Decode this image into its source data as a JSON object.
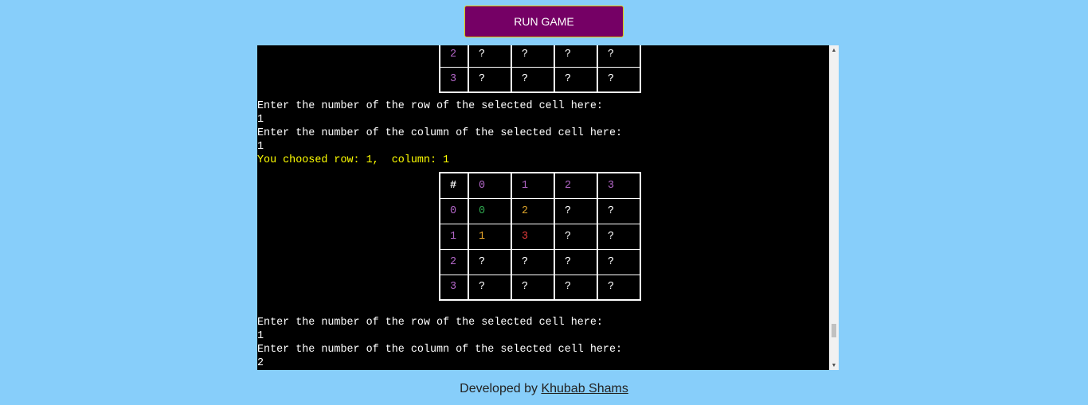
{
  "run_button": {
    "label": "RUN GAME"
  },
  "terminal": {
    "top_board_rows": [
      {
        "row": "2",
        "cells": [
          "?",
          "?",
          "?",
          "?"
        ]
      },
      {
        "row": "3",
        "cells": [
          "?",
          "?",
          "?",
          "?"
        ]
      }
    ],
    "prompt_row": "Enter the number of the row of the selected cell here:",
    "input_row_1": "1",
    "prompt_col": "Enter the number of the column of the selected cell here:",
    "input_col_1": "1",
    "chosen": "You choosed row: 1,  column: 1",
    "board": {
      "header": [
        "#",
        "0",
        "1",
        "2",
        "3"
      ],
      "rows": [
        {
          "row": "0",
          "cells": [
            "0",
            "2",
            "?",
            "?"
          ]
        },
        {
          "row": "1",
          "cells": [
            "1",
            "3",
            "?",
            "?"
          ]
        },
        {
          "row": "2",
          "cells": [
            "?",
            "?",
            "?",
            "?"
          ]
        },
        {
          "row": "3",
          "cells": [
            "?",
            "?",
            "?",
            "?"
          ]
        }
      ]
    },
    "prompt_row_2": "Enter the number of the row of the selected cell here:",
    "input_row_2": "1",
    "prompt_col_2": "Enter the number of the column of the selected cell here:",
    "input_col_2": "2"
  },
  "footer": {
    "prefix": "Developed by ",
    "author": "Khubab Shams"
  },
  "colors": {
    "page_bg": "#87cefa",
    "button_bg": "#750065",
    "button_border": "#e8c300",
    "terminal_bg": "#000000",
    "row_label": "#b266c7",
    "highlight": "#ffff00"
  }
}
